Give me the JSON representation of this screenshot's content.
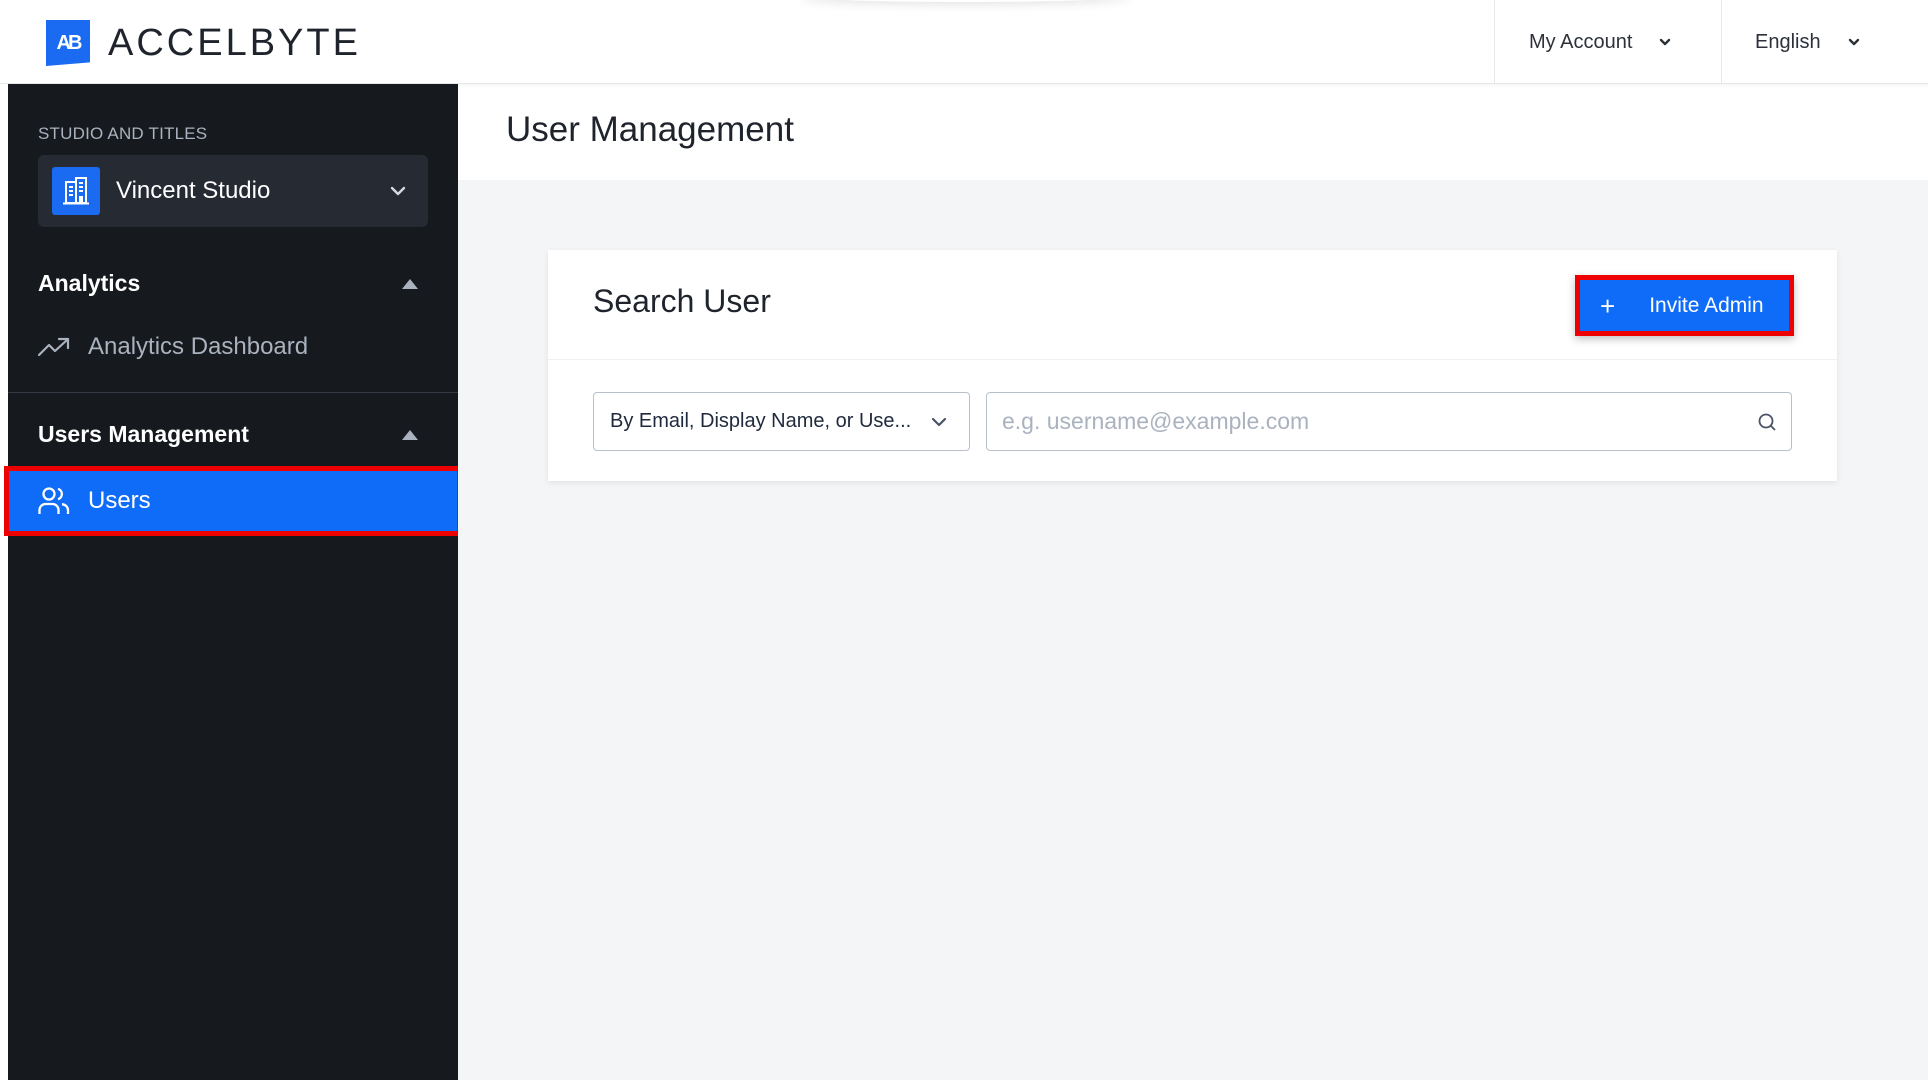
{
  "header": {
    "logo_text": "ACCELBYTE",
    "logo_mark": "AB",
    "account_menu_label": "My Account",
    "language_menu_label": "English"
  },
  "sidebar": {
    "studio_section_label": "STUDIO AND TITLES",
    "studio_selected": "Vincent Studio",
    "sections": [
      {
        "title": "Analytics",
        "expanded": true,
        "items": [
          {
            "label": "Analytics Dashboard",
            "icon": "trending-up-icon",
            "active": false
          }
        ]
      },
      {
        "title": "Users Management",
        "expanded": true,
        "items": [
          {
            "label": "Users",
            "icon": "users-icon",
            "active": true
          }
        ]
      }
    ]
  },
  "main": {
    "page_title": "User Management",
    "card": {
      "title": "Search User",
      "invite_button_label": "Invite Admin",
      "invite_button_icon": "plus-icon",
      "filter_selected": "By Email, Display Name, or Use...",
      "search_value": "",
      "search_placeholder": "e.g. username@example.com"
    }
  },
  "colors": {
    "brand_blue": "#0f6cf8",
    "sidebar_bg": "#16191e",
    "highlight_red": "#ee0000",
    "page_bg": "#f4f5f7"
  }
}
